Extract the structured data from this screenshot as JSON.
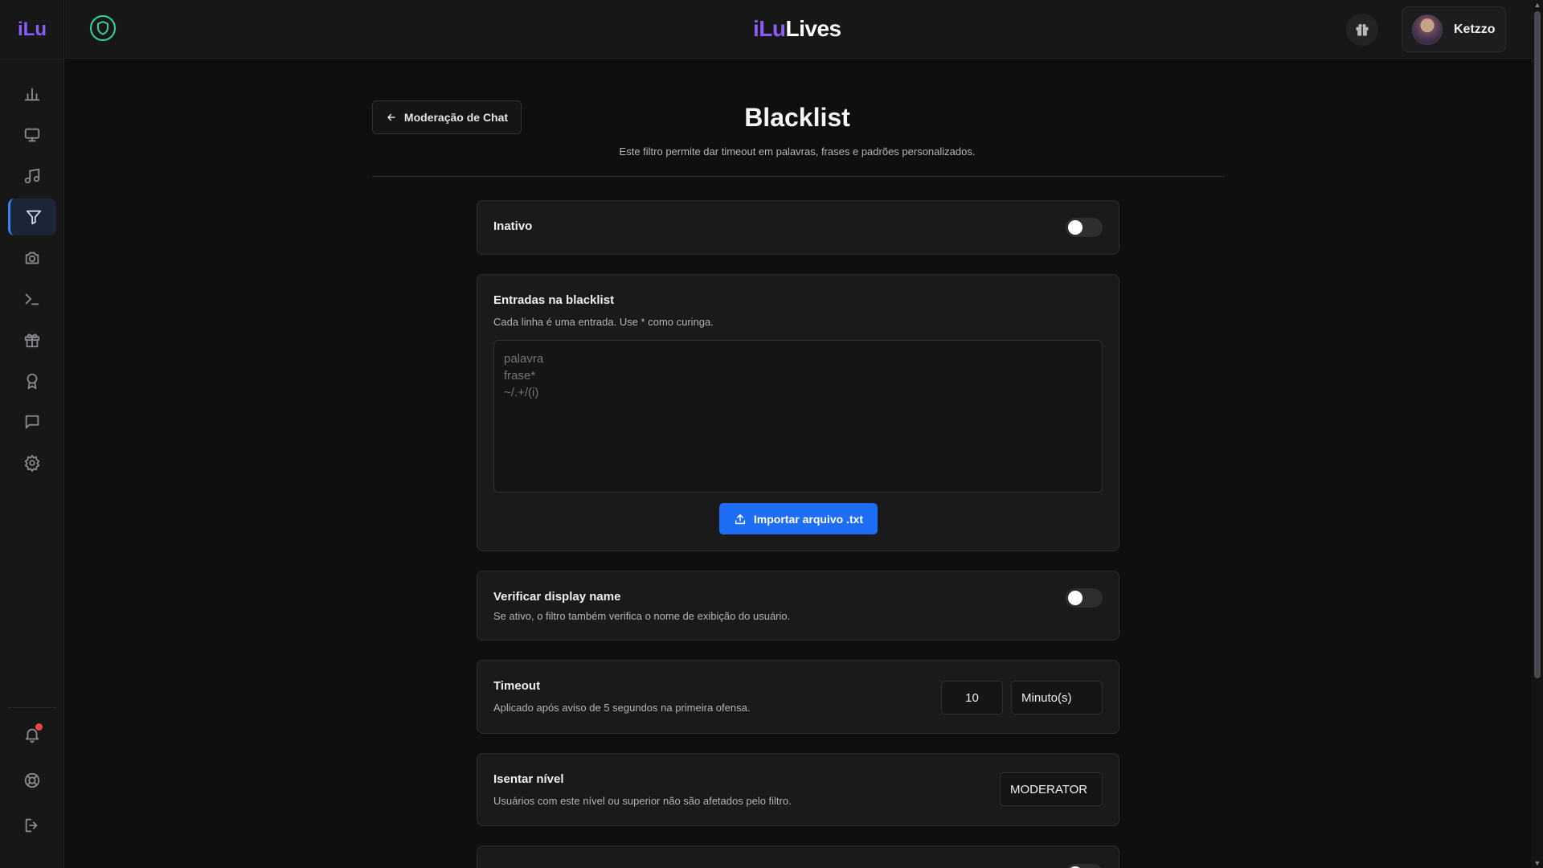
{
  "brand": {
    "logo_small": "iLu",
    "part1": "iLu",
    "part2": "Lives"
  },
  "user": {
    "name": "Ketzzo"
  },
  "header": {
    "back_label": "Moderação de Chat",
    "title": "Blacklist",
    "subtitle": "Este filtro permite dar timeout em palavras, frases e padrões personalizados."
  },
  "status_card": {
    "label": "Inativo",
    "enabled": false
  },
  "entries_card": {
    "title": "Entradas na blacklist",
    "description": "Cada linha é uma entrada. Use * como curinga.",
    "placeholder": "palavra\nfrase*\n~/.+/(i)",
    "import_label": "Importar arquivo .txt"
  },
  "display_name_card": {
    "title": "Verificar display name",
    "description": "Se ativo, o filtro também verifica o nome de exibição do usuário.",
    "enabled": false
  },
  "timeout_card": {
    "title": "Timeout",
    "description": "Aplicado após aviso de 5 segundos na primeira ofensa.",
    "value": "10",
    "unit": "Minuto(s)"
  },
  "exempt_card": {
    "title": "Isentar nível",
    "description": "Usuários com este nível ou superior não são afetados pelo filtro.",
    "level": "MODERATOR"
  },
  "sidebar": {
    "items": [
      {
        "icon": "bar-chart-icon"
      },
      {
        "icon": "monitor-icon"
      },
      {
        "icon": "music-icon"
      },
      {
        "icon": "filter-icon",
        "active": true
      },
      {
        "icon": "camera-icon"
      },
      {
        "icon": "terminal-icon"
      },
      {
        "icon": "gift-icon"
      },
      {
        "icon": "award-icon"
      },
      {
        "icon": "message-icon"
      },
      {
        "icon": "settings-icon"
      }
    ],
    "bottom": [
      {
        "icon": "bell-icon",
        "has_notification": true
      },
      {
        "icon": "lifebuoy-icon"
      },
      {
        "icon": "logout-icon"
      }
    ]
  },
  "colors": {
    "accent": "#1d6ef5",
    "brand_purple": "#8b5cf6",
    "shield_green": "#34d399"
  }
}
